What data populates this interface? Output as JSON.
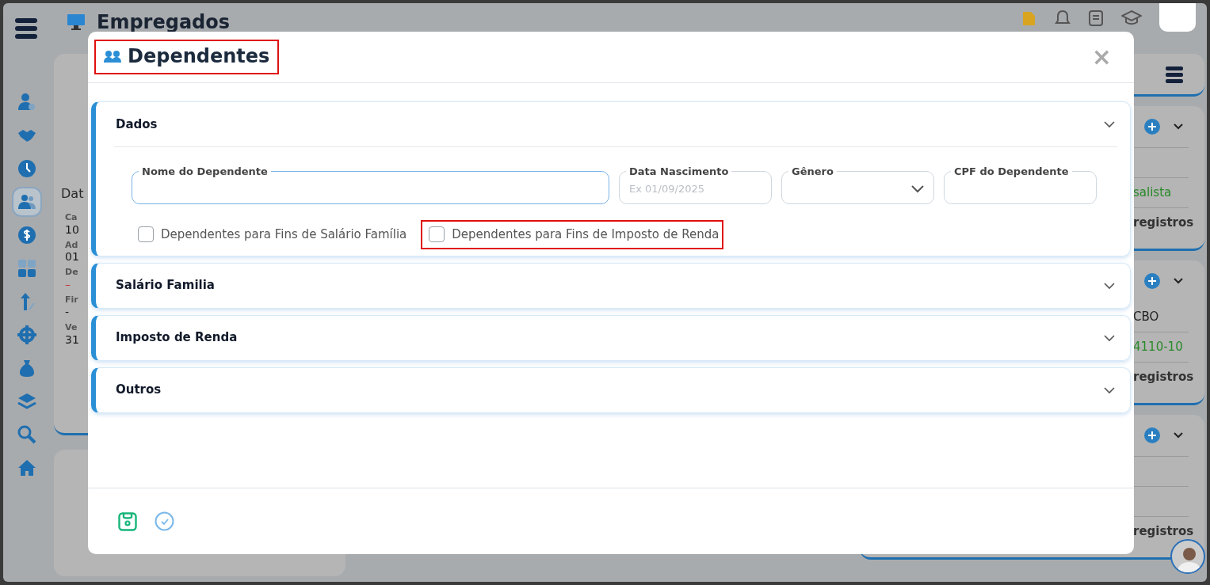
{
  "app": {
    "title": "Empregados",
    "sidebar": {
      "items": [
        {
          "selected": false
        },
        {
          "selected": false
        },
        {
          "selected": false
        },
        {
          "selected": true
        },
        {
          "selected": false
        },
        {
          "selected": false
        },
        {
          "selected": false
        },
        {
          "selected": false
        },
        {
          "selected": false
        },
        {
          "selected": false
        },
        {
          "selected": false
        },
        {
          "selected": false
        }
      ]
    },
    "left_panel": {
      "heading": "Dat",
      "fields": [
        {
          "label": "Ca",
          "value": "10",
          "kind": "plain"
        },
        {
          "label": "Ad",
          "value": "01",
          "kind": "plain"
        },
        {
          "label": "De",
          "value": "–",
          "kind": "missing"
        },
        {
          "label": "Fir",
          "value": "-",
          "kind": "plain"
        },
        {
          "label": "Ve",
          "value": "31",
          "kind": "plain"
        }
      ]
    },
    "right_cards": [
      {
        "kind": "menu"
      },
      {
        "rows": [
          {
            "text": "",
            "kind": "blank"
          },
          {
            "text": "salista",
            "kind": "status"
          },
          {
            "text": "registros",
            "kind": "count"
          }
        ]
      },
      {
        "rows": [
          {
            "text": "CBO",
            "kind": "label"
          },
          {
            "text": "4110-10",
            "kind": "status"
          },
          {
            "text": "registros",
            "kind": "count"
          }
        ]
      },
      {
        "rows": [
          {
            "text": "",
            "kind": "blank"
          },
          {
            "text": "",
            "kind": "blank"
          },
          {
            "text": "registros",
            "kind": "count"
          }
        ]
      }
    ]
  },
  "modal": {
    "title": "Dependentes",
    "title_highlighted": true,
    "close_label": "×",
    "sections": [
      {
        "title": "Dados",
        "expanded": true,
        "fields": [
          {
            "label": "Nome do Dependente",
            "kind": "text",
            "focused": true
          },
          {
            "label": "Data Nascimento",
            "kind": "text",
            "placeholder": "Ex 01/09/2025",
            "focused": false
          },
          {
            "label": "Gênero",
            "kind": "select",
            "focused": false
          },
          {
            "label": "CPF do Dependente",
            "kind": "text",
            "focused": false
          }
        ],
        "checkboxes": [
          {
            "label": "Dependentes para Fins de Salário Família",
            "checked": false,
            "highlighted": false
          },
          {
            "label": "Dependentes para Fins de Imposto de Renda",
            "checked": false,
            "highlighted": true
          }
        ]
      },
      {
        "title": "Salário Familia",
        "expanded": false
      },
      {
        "title": "Imposto de Renda",
        "expanded": false
      },
      {
        "title": "Outros",
        "expanded": false
      }
    ]
  }
}
